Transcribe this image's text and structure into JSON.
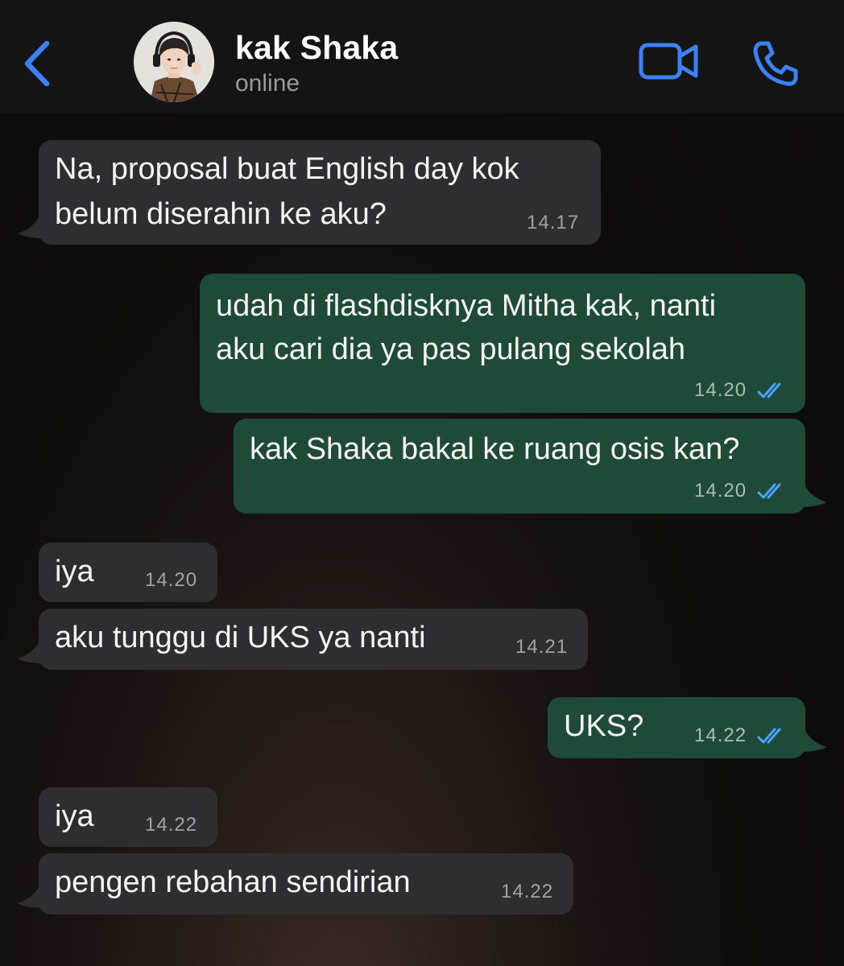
{
  "header": {
    "contact_name": "kak Shaka",
    "status": "online",
    "back_icon": "chevron-left-icon",
    "video_icon": "video-camera-icon",
    "call_icon": "phone-icon",
    "accent_color": "#3b82f6"
  },
  "messages": [
    {
      "direction": "in",
      "lines": [
        "Na, proposal buat English day kok",
        "belum diserahin ke aku?"
      ],
      "time": "14.17"
    },
    {
      "direction": "out",
      "lines": [
        "udah di flashdisknya Mitha kak, nanti",
        "aku cari dia ya pas pulang sekolah"
      ],
      "time": "14.20",
      "status": "read"
    },
    {
      "direction": "out",
      "lines": [
        "kak Shaka bakal ke ruang osis kan?"
      ],
      "time": "14.20",
      "status": "read"
    },
    {
      "direction": "in",
      "lines": [
        "iya"
      ],
      "time": "14.20"
    },
    {
      "direction": "in",
      "lines": [
        "aku tunggu di UKS ya nanti"
      ],
      "time": "14.21"
    },
    {
      "direction": "out",
      "lines": [
        "UKS?"
      ],
      "time": "14.22",
      "status": "read"
    },
    {
      "direction": "in",
      "lines": [
        "iya"
      ],
      "time": "14.22"
    },
    {
      "direction": "in",
      "lines": [
        "pengen rebahan sendirian"
      ],
      "time": "14.22"
    }
  ],
  "colors": {
    "incoming_bubble": "#2e2e30",
    "outgoing_bubble": "#1f4a3a",
    "read_ticks": "#4aa3ff"
  }
}
